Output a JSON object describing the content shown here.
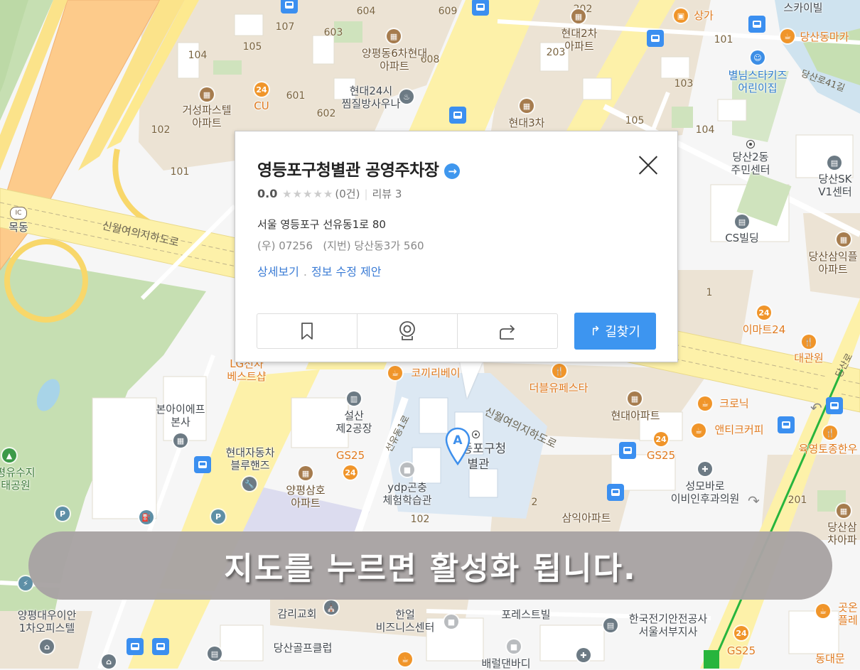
{
  "popup": {
    "title": "영등포구청별관 공영주차장",
    "title_arrow_icon": "→",
    "rating_score": "0.0",
    "rating_stars": "★★★★★",
    "rating_count": "(0건)",
    "review_label": "리뷰 3",
    "address": "서울 영등포구 선유동1로 80",
    "postal": "(우) 07256",
    "lot_address": "(지번) 당산동3가 560",
    "links": [
      "상세보기",
      "정보 수정 제안"
    ],
    "link_separator": ".",
    "route_button": "길찾기",
    "route_icon": "↱"
  },
  "banner": {
    "text": "지도를 누르면 활성화 됩니다."
  },
  "marker": {
    "label": "A",
    "place": "영등포구청\n별관"
  },
  "map": {
    "colors": {
      "green_area": "#c6dfb2",
      "road_yellow": "#fdf1a9",
      "highway_orange": "#fdcb8b",
      "residential": "#ece3d4",
      "highlight_area": "#dce8f3",
      "subway_line": "#27b53d"
    },
    "labels": [
      {
        "id": "l1",
        "text": "거성파스텔\n아파트",
        "color": "brown"
      },
      {
        "id": "l2",
        "text": "CU",
        "color": "orange"
      },
      {
        "id": "l3",
        "text": "양평동6차현대\n아파트",
        "color": "brown"
      },
      {
        "id": "l4",
        "text": "현대24시\n찜질방사우나",
        "color": "gray"
      },
      {
        "id": "l5",
        "text": "현대2차\n아파트",
        "color": "brown"
      },
      {
        "id": "l6",
        "text": "현대3차",
        "color": "brown"
      },
      {
        "id": "l7",
        "text": "상가",
        "color": "orange"
      },
      {
        "id": "l8",
        "text": "스카이빌",
        "color": "gray"
      },
      {
        "id": "l9",
        "text": "당산동마카",
        "color": "orange"
      },
      {
        "id": "l10",
        "text": "별님스타키즈\n어린이집",
        "color": "blue"
      },
      {
        "id": "l11",
        "text": "당산2동\n주민센터",
        "color": "gray"
      },
      {
        "id": "l12",
        "text": "당산SK\nV1센터",
        "color": "gray"
      },
      {
        "id": "l13",
        "text": "CS빌딩",
        "color": "gray"
      },
      {
        "id": "l14",
        "text": "당산삼익플\n아파트",
        "color": "brown"
      },
      {
        "id": "l15",
        "text": "이마트24",
        "color": "orange"
      },
      {
        "id": "l16",
        "text": "대관원",
        "color": "orange"
      },
      {
        "id": "l17",
        "text": "목동",
        "color": "gray"
      },
      {
        "id": "l18",
        "text": "LG전자\n베스트샵",
        "color": "orange"
      },
      {
        "id": "l19",
        "text": "본아이에프\n본사",
        "color": "gray"
      },
      {
        "id": "l20",
        "text": "평유수지\n태공원",
        "color": "green"
      },
      {
        "id": "l21",
        "text": "현대자동차\n블루핸즈",
        "color": "gray"
      },
      {
        "id": "l22",
        "text": "양평삼호\n아파트",
        "color": "brown"
      },
      {
        "id": "l23",
        "text": "설산\n제2공장",
        "color": "gray"
      },
      {
        "id": "l24",
        "text": "GS25",
        "color": "orange"
      },
      {
        "id": "l25",
        "text": "코끼리베이",
        "color": "orange"
      },
      {
        "id": "l26",
        "text": "ydp곤충\n체험학습관",
        "color": "gray"
      },
      {
        "id": "l27",
        "text": "더블유페스타",
        "color": "orange"
      },
      {
        "id": "l28",
        "text": "현대아파트",
        "color": "brown"
      },
      {
        "id": "l29",
        "text": "GS25",
        "color": "orange"
      },
      {
        "id": "l30",
        "text": "크로닉",
        "color": "orange"
      },
      {
        "id": "l31",
        "text": "앤티크커피",
        "color": "orange"
      },
      {
        "id": "l32",
        "text": "육영토종한우",
        "color": "orange"
      },
      {
        "id": "l33",
        "text": "성모바로\n이비인후과의원",
        "color": "gray"
      },
      {
        "id": "l34",
        "text": "삼익아파트",
        "color": "brown"
      },
      {
        "id": "l35",
        "text": "당산삼\n차아파",
        "color": "brown"
      },
      {
        "id": "l36",
        "text": "양평대우이안\n1차오피스텔",
        "color": "gray"
      },
      {
        "id": "l37",
        "text": "감리교회",
        "color": "gray"
      },
      {
        "id": "l38",
        "text": "한얼\n비즈니스센터",
        "color": "gray"
      },
      {
        "id": "l39",
        "text": "포레스트빌",
        "color": "gray"
      },
      {
        "id": "l40",
        "text": "한국전기안전공사\n서울서부지사",
        "color": "gray"
      },
      {
        "id": "l41",
        "text": "당산골프클럽",
        "color": "gray"
      },
      {
        "id": "l42",
        "text": "GS25",
        "color": "orange"
      },
      {
        "id": "l43",
        "text": "곳온\n플레",
        "color": "orange"
      },
      {
        "id": "l44",
        "text": "동대문",
        "color": "orange"
      },
      {
        "id": "l45",
        "text": "배럴댄바디",
        "color": "gray"
      }
    ],
    "numbers": [
      "107",
      "604",
      "609",
      "202",
      "603",
      "104",
      "105",
      "608",
      "203",
      "101",
      "601",
      "602",
      "103",
      "102",
      "101",
      "105",
      "104",
      "1",
      "2",
      "102",
      "201"
    ],
    "road_labels": [
      "신월여의지하도로",
      "신월여의지하도로",
      "선유동1로",
      "당산로41길",
      "당산로"
    ],
    "ic_badge": "IC"
  }
}
